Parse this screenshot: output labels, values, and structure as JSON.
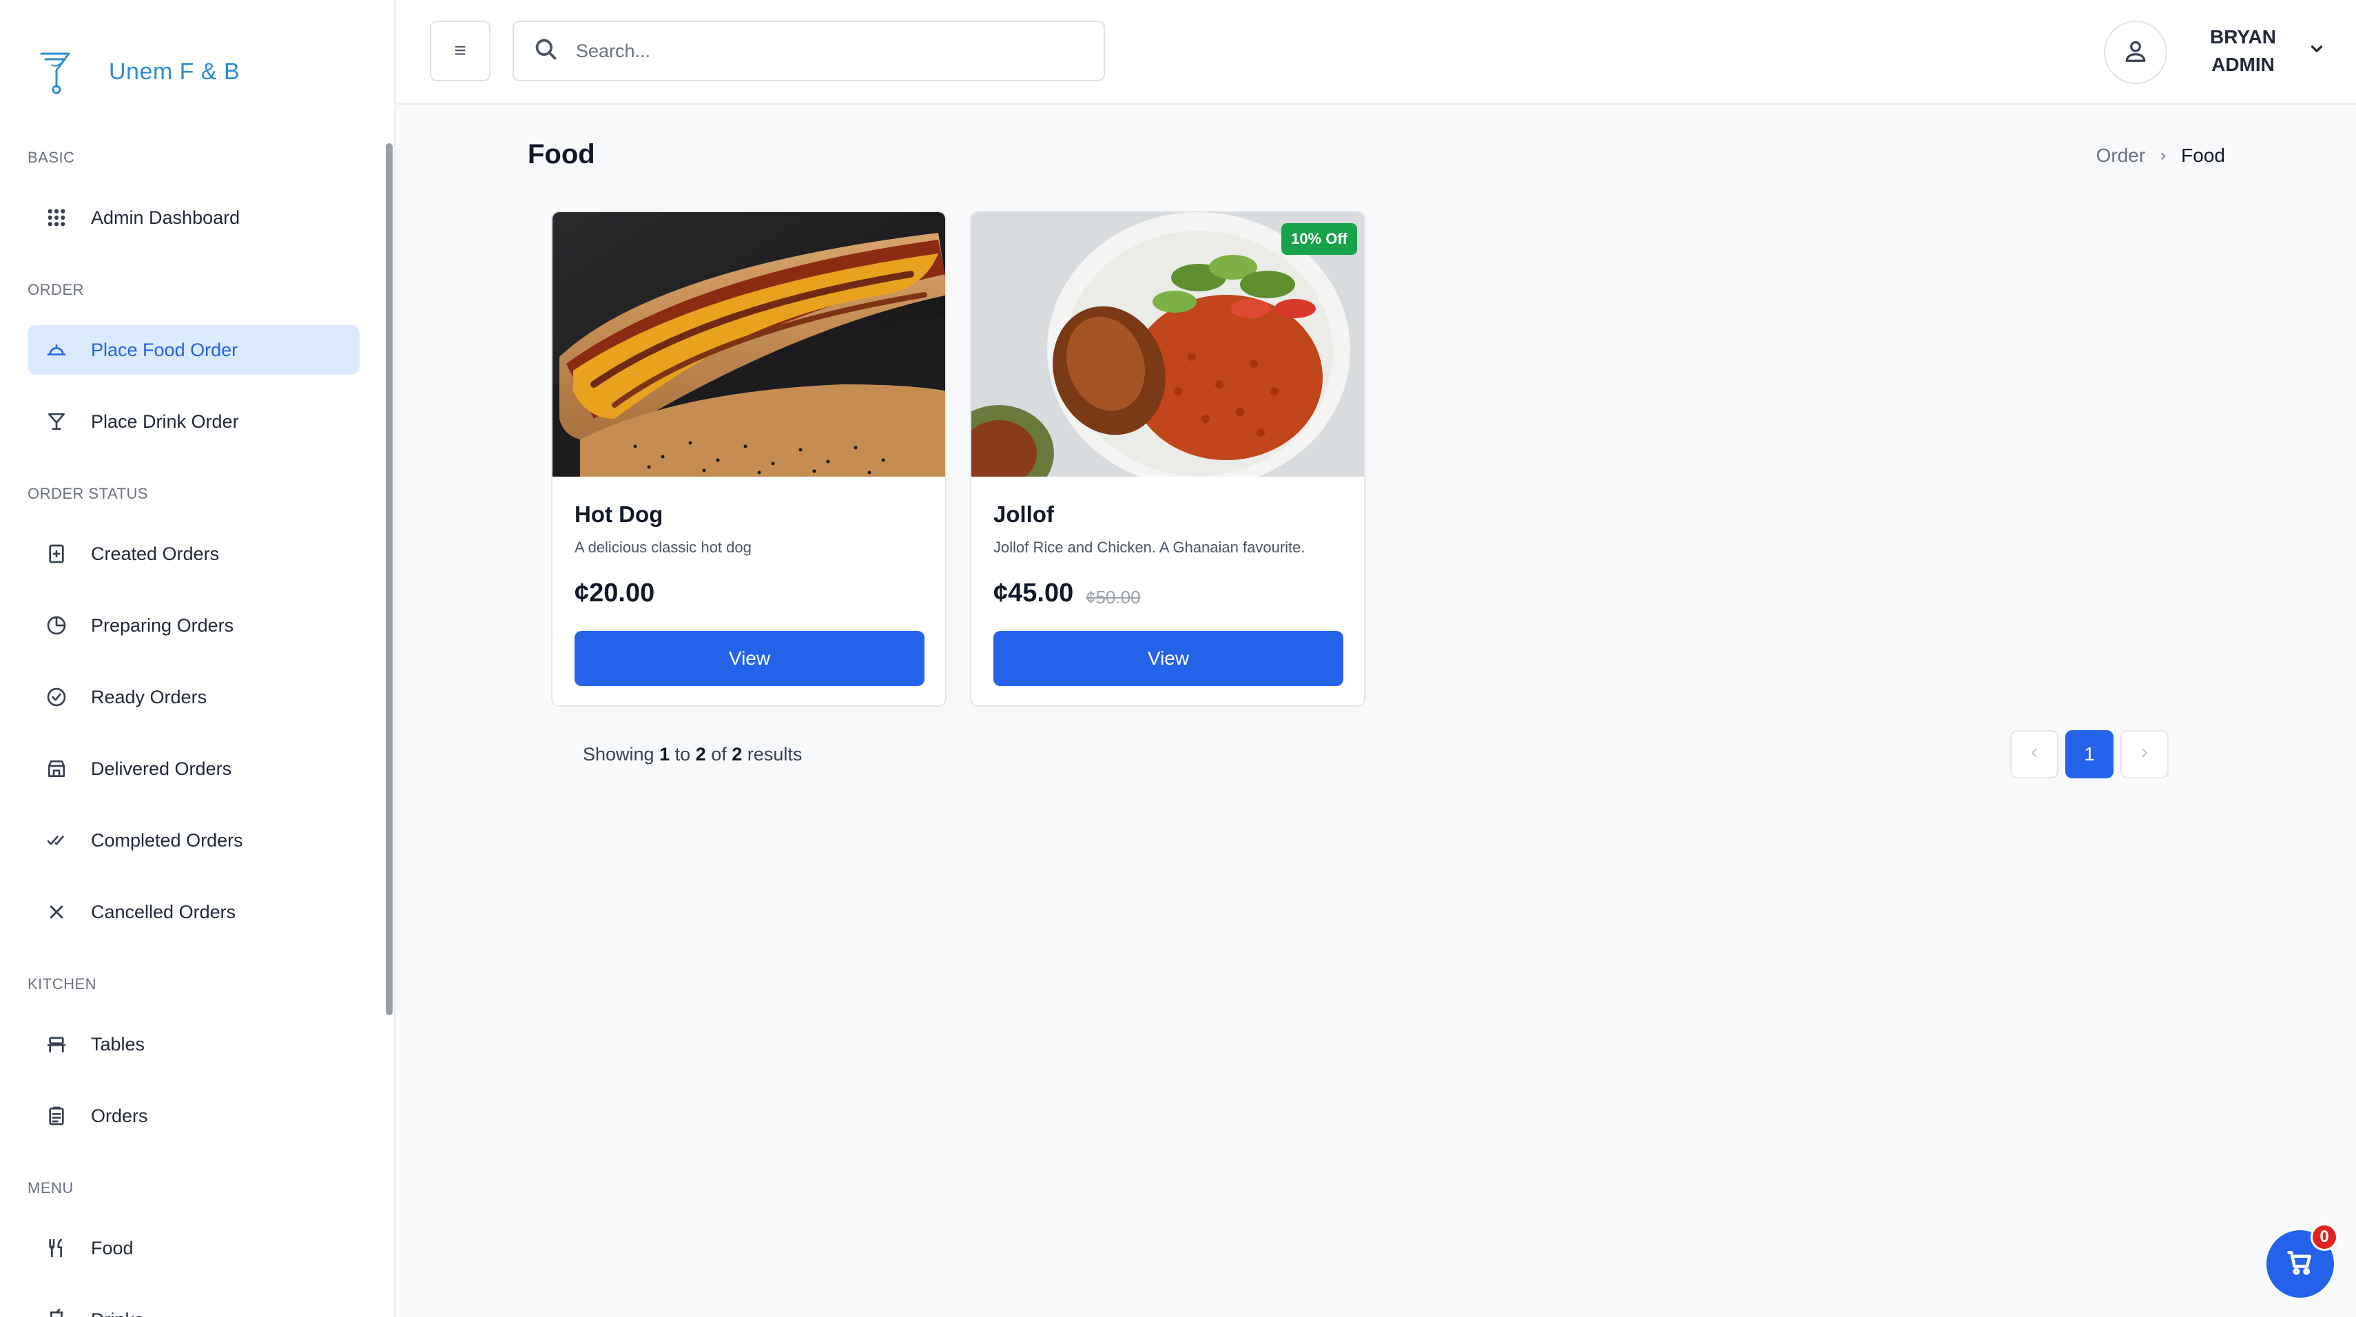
{
  "brand": {
    "name": "Unem F & B",
    "logo_icon": "cocktail-glass-icon"
  },
  "sidebar": {
    "sections": [
      {
        "label": "BASIC",
        "items": [
          {
            "label": "Admin Dashboard",
            "icon": "grid-dots-icon"
          }
        ]
      },
      {
        "label": "ORDER",
        "items": [
          {
            "label": "Place Food Order",
            "icon": "cloche-icon",
            "active": true
          },
          {
            "label": "Place Drink Order",
            "icon": "cocktail-icon"
          }
        ]
      },
      {
        "label": "ORDER STATUS",
        "items": [
          {
            "label": "Created Orders",
            "icon": "plus-square-icon"
          },
          {
            "label": "Preparing Orders",
            "icon": "pie-clock-icon"
          },
          {
            "label": "Ready Orders",
            "icon": "check-circle-icon"
          },
          {
            "label": "Delivered Orders",
            "icon": "store-icon"
          },
          {
            "label": "Completed Orders",
            "icon": "double-check-icon"
          },
          {
            "label": "Cancelled Orders",
            "icon": "x-icon"
          }
        ]
      },
      {
        "label": "KITCHEN",
        "items": [
          {
            "label": "Tables",
            "icon": "table-icon"
          },
          {
            "label": "Orders",
            "icon": "clipboard-icon"
          }
        ]
      },
      {
        "label": "MENU",
        "items": [
          {
            "label": "Food",
            "icon": "fork-knife-icon"
          },
          {
            "label": "Drinks",
            "icon": "drink-icon"
          }
        ]
      }
    ]
  },
  "header": {
    "search_placeholder": "Search...",
    "user": {
      "first": "BRYAN",
      "second": "ADMIN"
    }
  },
  "page": {
    "title": "Food",
    "breadcrumb": {
      "parent": "Order",
      "current": "Food"
    }
  },
  "products": [
    {
      "name": "Hot Dog",
      "description": "A delicious classic hot dog",
      "price": "¢20.00",
      "old_price": "",
      "badge": "",
      "button": "View"
    },
    {
      "name": "Jollof",
      "description": "Jollof Rice and Chicken. A Ghanaian favourite.",
      "price": "¢45.00",
      "old_price": "¢50.00",
      "badge": "10% Off",
      "button": "View"
    }
  ],
  "pagination": {
    "showing_prefix": "Showing",
    "from": "1",
    "to_word": "to",
    "to": "2",
    "of_word": "of",
    "total": "2",
    "suffix": "results",
    "current_page": "1"
  },
  "cart": {
    "count": "0"
  },
  "colors": {
    "accent": "#2563eb",
    "brand": "#2a8fd0",
    "badge": "#16a34a",
    "cart_count": "#e02424",
    "active_bg": "#dbeafe"
  }
}
